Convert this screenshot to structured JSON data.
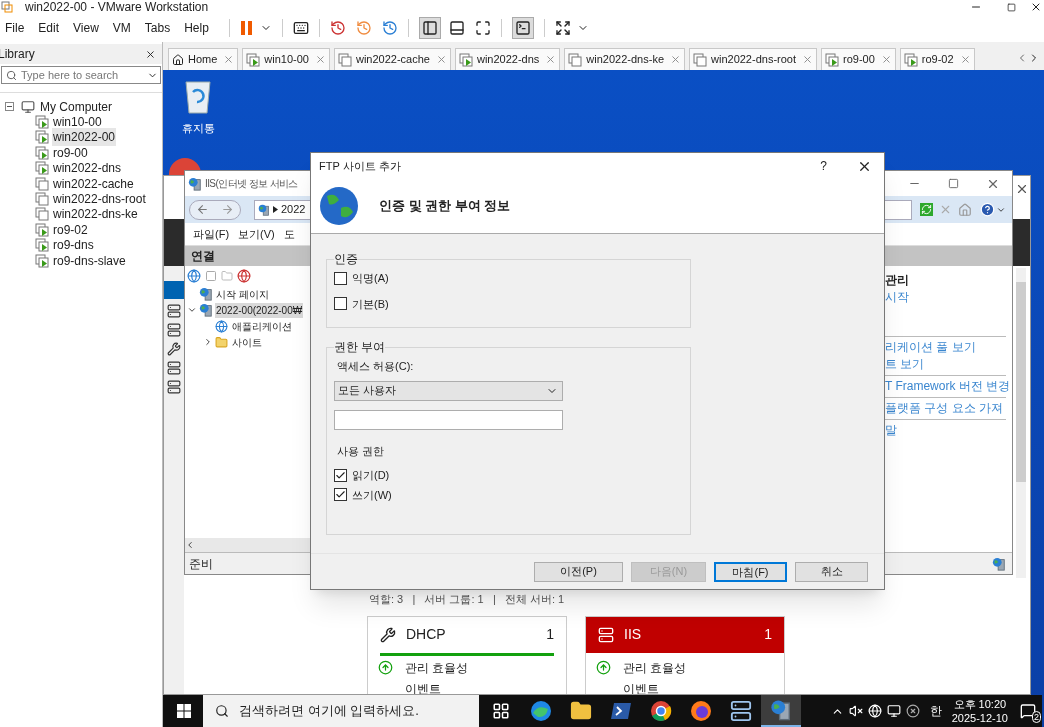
{
  "window": {
    "title": "win2022-00 - VMware Workstation"
  },
  "menu": [
    "File",
    "Edit",
    "View",
    "VM",
    "Tabs",
    "Help"
  ],
  "library": {
    "title": "Library",
    "search": {
      "placeholder": "Type here to search"
    },
    "tree": [
      {
        "label": "My Computer",
        "expanded": true,
        "children": [
          {
            "label": "win10-00",
            "running": true,
            "selected": false
          },
          {
            "label": "win2022-00",
            "running": true,
            "selected": true
          },
          {
            "label": "ro9-00",
            "running": true,
            "selected": false
          },
          {
            "label": "win2022-dns",
            "running": true,
            "selected": false
          },
          {
            "label": "win2022-cache",
            "running": false,
            "selected": false
          },
          {
            "label": "win2022-dns-root",
            "running": false,
            "selected": false
          },
          {
            "label": "win2022-dns-ke",
            "running": false,
            "selected": false
          },
          {
            "label": "ro9-02",
            "running": true,
            "selected": false
          },
          {
            "label": "ro9-dns",
            "running": true,
            "selected": false
          },
          {
            "label": "ro9-dns-slave",
            "running": true,
            "selected": false
          }
        ]
      }
    ]
  },
  "tabs": [
    {
      "label": "Home",
      "kind": "home"
    },
    {
      "label": "win10-00",
      "kind": "vm",
      "running": true
    },
    {
      "label": "win2022-cache",
      "kind": "vm",
      "running": false
    },
    {
      "label": "win2022-dns",
      "kind": "vm",
      "running": true
    },
    {
      "label": "win2022-dns-ke",
      "kind": "vm",
      "running": false
    },
    {
      "label": "win2022-dns-root",
      "kind": "vm",
      "running": false
    },
    {
      "label": "ro9-00",
      "kind": "vm",
      "running": true
    },
    {
      "label": "ro9-02",
      "kind": "vm",
      "running": true
    }
  ],
  "guest": {
    "desktop_icons": [
      {
        "label": "휴지통"
      }
    ],
    "iis": {
      "title": "IIS(인터넷 정보 서비스",
      "address": "2022",
      "menu": [
        "파일(F)",
        "보기(V)",
        "도"
      ],
      "connections_title": "연결",
      "tree": [
        {
          "label": "시작 페이지",
          "kind": "start"
        },
        {
          "label": "2022-00(2022-00₩",
          "kind": "server",
          "selected": true,
          "expanded": true,
          "children": [
            {
              "label": "애플리케이션",
              "kind": "apppool"
            },
            {
              "label": "사이트",
              "kind": "sites",
              "expanded": false
            }
          ]
        }
      ],
      "action_groups": [
        [
          {
            "label": "관리",
            "kind": "heading"
          },
          {
            "label": "시작",
            "kind": "link"
          }
        ],
        [
          {
            "label": "리케이션 풀 보기",
            "kind": "link"
          },
          {
            "label": "트 보기",
            "kind": "link"
          }
        ],
        [
          {
            "label": "T Framework 버전 변경",
            "kind": "link"
          }
        ],
        [
          {
            "label": "플랫폼 구성 요소 가져",
            "kind": "link"
          }
        ],
        [
          {
            "label": "말",
            "kind": "link"
          }
        ]
      ],
      "status": "준비"
    },
    "dialog": {
      "title": "FTP 사이트 추가",
      "help": "?",
      "heading": "인증 및 권한 부여 정보",
      "authentication": {
        "title": "인증",
        "options": [
          {
            "label": "익명(A)",
            "checked": false
          },
          {
            "label": "기본(B)",
            "checked": false
          }
        ]
      },
      "authorization": {
        "title": "권한 부여",
        "access_label": "액세스 허용(C):",
        "access_value": "모든 사용자",
        "permissions_title": "사용 권한",
        "permissions": [
          {
            "label": "읽기(D)",
            "checked": true
          },
          {
            "label": "쓰기(W)",
            "checked": true
          }
        ]
      },
      "buttons": [
        {
          "label": "이전(P)",
          "disabled": false,
          "default": false
        },
        {
          "label": "다음(N)",
          "disabled": true,
          "default": false
        },
        {
          "label": "마침(F)",
          "disabled": false,
          "default": true
        },
        {
          "label": "취소",
          "disabled": false,
          "default": false
        }
      ]
    },
    "server_manager": {
      "summary": "역할: 3   |   서버 그룹: 1   |   전체 서버: 1",
      "roles": [
        {
          "name": "DHCP",
          "count": "1",
          "alert": false,
          "items": [
            "관리 효율성",
            "이벤트"
          ]
        },
        {
          "name": "IIS",
          "count": "1",
          "alert": true,
          "items": [
            "관리 효율성",
            "이벤트"
          ]
        }
      ]
    },
    "taskbar": {
      "search": {
        "placeholder": "검색하려면 여기에 입력하세요."
      },
      "apps": [
        {
          "kind": "taskview",
          "active": false
        },
        {
          "kind": "edge",
          "active": false
        },
        {
          "kind": "explorer",
          "active": false
        },
        {
          "kind": "powershell",
          "active": false
        },
        {
          "kind": "chrome",
          "active": false
        },
        {
          "kind": "firefox",
          "active": false
        },
        {
          "kind": "servermanager",
          "active": false
        },
        {
          "kind": "iis",
          "active": true
        }
      ],
      "ime": "한",
      "time": "오후 10:20",
      "date": "2025-12-10",
      "notifications": "2"
    }
  }
}
